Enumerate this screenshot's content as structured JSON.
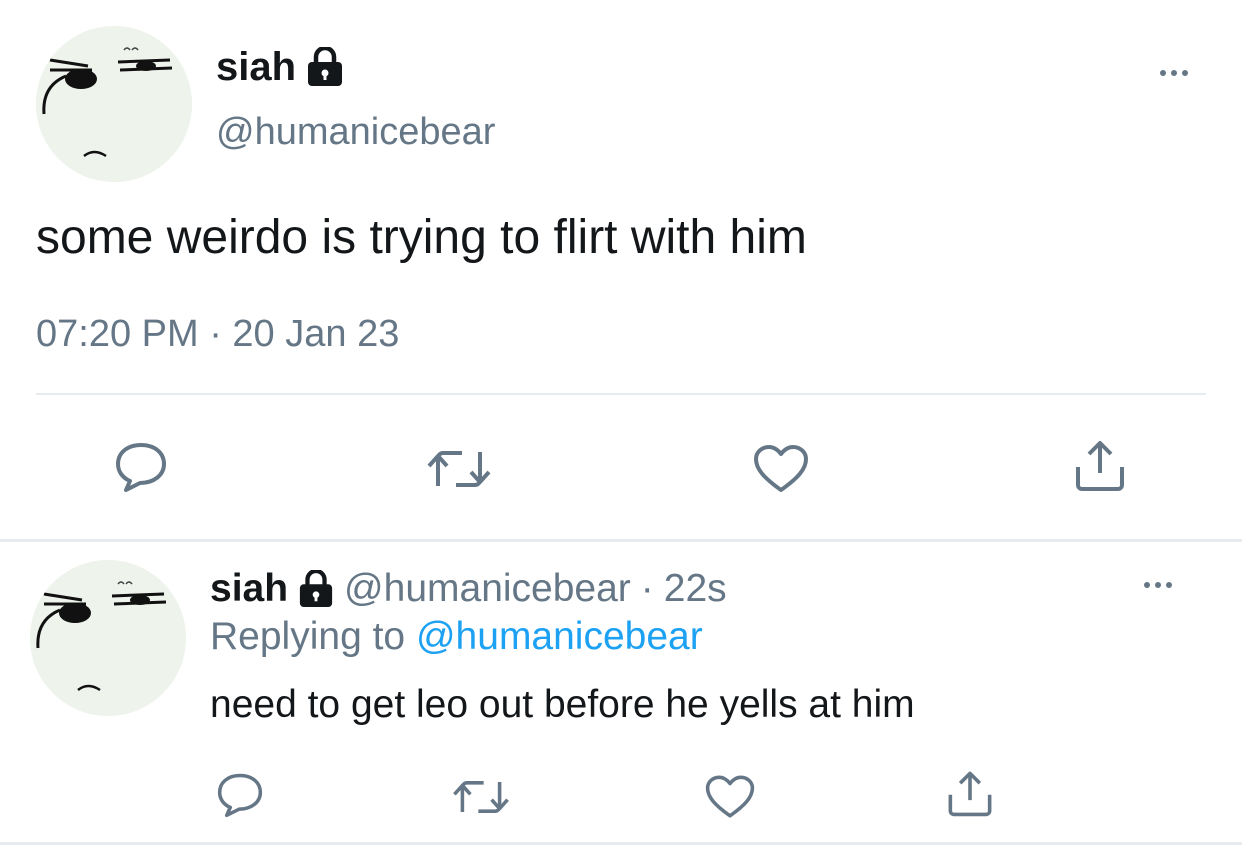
{
  "main_tweet": {
    "display_name": "siah",
    "handle": "@humanicebear",
    "text": "some weirdo is trying to flirt with him",
    "timestamp": "07:20 PM · 20 Jan 23",
    "avatar_icon": "angry-face-avatar-icon",
    "locked_icon": "lock-icon"
  },
  "reply_tweet": {
    "display_name": "siah",
    "handle": "@humanicebear",
    "separator": "·",
    "age": "22s",
    "replying_label": "Replying to",
    "replying_handle": "@humanicebear",
    "text": "need to get leo out before he yells at him",
    "avatar_icon": "angry-face-avatar-icon",
    "locked_icon": "lock-icon"
  },
  "actions": [
    "reply-icon",
    "retweet-icon",
    "like-icon",
    "share-icon"
  ],
  "colors": {
    "text": "#14171a",
    "muted": "#657786",
    "link": "#1da1f2",
    "divider": "#e6ecf0",
    "avatar_bg": "#eef3ec"
  }
}
